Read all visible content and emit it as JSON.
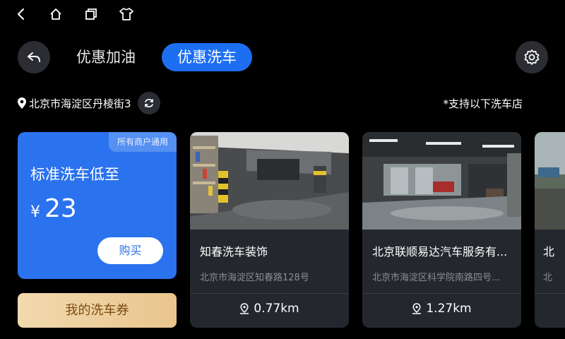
{
  "system_bar": {
    "icons": [
      "chevron-left-icon",
      "home-icon",
      "recent-apps-icon",
      "shirt-icon"
    ]
  },
  "header": {
    "tabs": [
      {
        "label": "优惠加油",
        "selected": false
      },
      {
        "label": "优惠洗车",
        "selected": true
      }
    ]
  },
  "location": {
    "text": "北京市海淀区丹棱街3",
    "support_note": "*支持以下洗车店"
  },
  "promo": {
    "badge": "所有商户通用",
    "title": "标准洗车低至",
    "currency": "¥",
    "price": "23",
    "buy_label": "购买"
  },
  "coupon": {
    "label": "我的洗车券"
  },
  "shops": [
    {
      "name": "知春洗车装饰",
      "address": "北京市海淀区知春路128号",
      "distance": "0.77km"
    },
    {
      "name": "北京联顺易达汽车服务有...",
      "address": "北京市海淀区科学院南路四号...",
      "distance": "1.27km"
    },
    {
      "name": "北",
      "address": "北"
    }
  ],
  "colors": {
    "accent": "#1d6ff2",
    "promo_bg": "#2a72ee",
    "card_bg": "#25272e",
    "coupon_gold": "#e9c58d"
  }
}
